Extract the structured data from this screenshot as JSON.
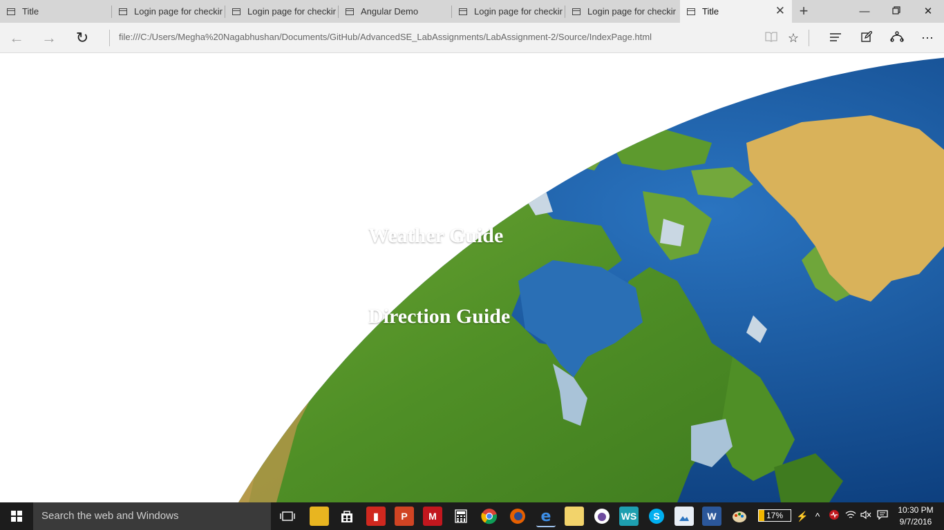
{
  "browser": {
    "tabs": [
      {
        "title": "Title",
        "active": false
      },
      {
        "title": "Login page for checkir",
        "active": false
      },
      {
        "title": "Login page for checkir",
        "active": false
      },
      {
        "title": "Angular Demo",
        "active": false
      },
      {
        "title": "Login page for checkir",
        "active": false
      },
      {
        "title": "Login page for checkir",
        "active": false
      },
      {
        "title": "Title",
        "active": true
      }
    ],
    "address": "file:///C:/Users/Megha%20Nagabhushan/Documents/GitHub/AdvancedSE_LabAssignments/LabAssignment-2/Source/IndexPage.html"
  },
  "page": {
    "weather_link": "Weather Guide",
    "direction_link": "Direction Guide"
  },
  "taskbar": {
    "search_placeholder": "Search the web and Windows",
    "battery_percent": "17%",
    "battery_level": 0.17,
    "time": "10:30 PM",
    "date": "9/7/2016"
  },
  "colors": {
    "ocean": "#1f5fa8",
    "land": "#5d9a2e",
    "desert": "#d9b25a",
    "taskbar": "#1c1c1c"
  }
}
